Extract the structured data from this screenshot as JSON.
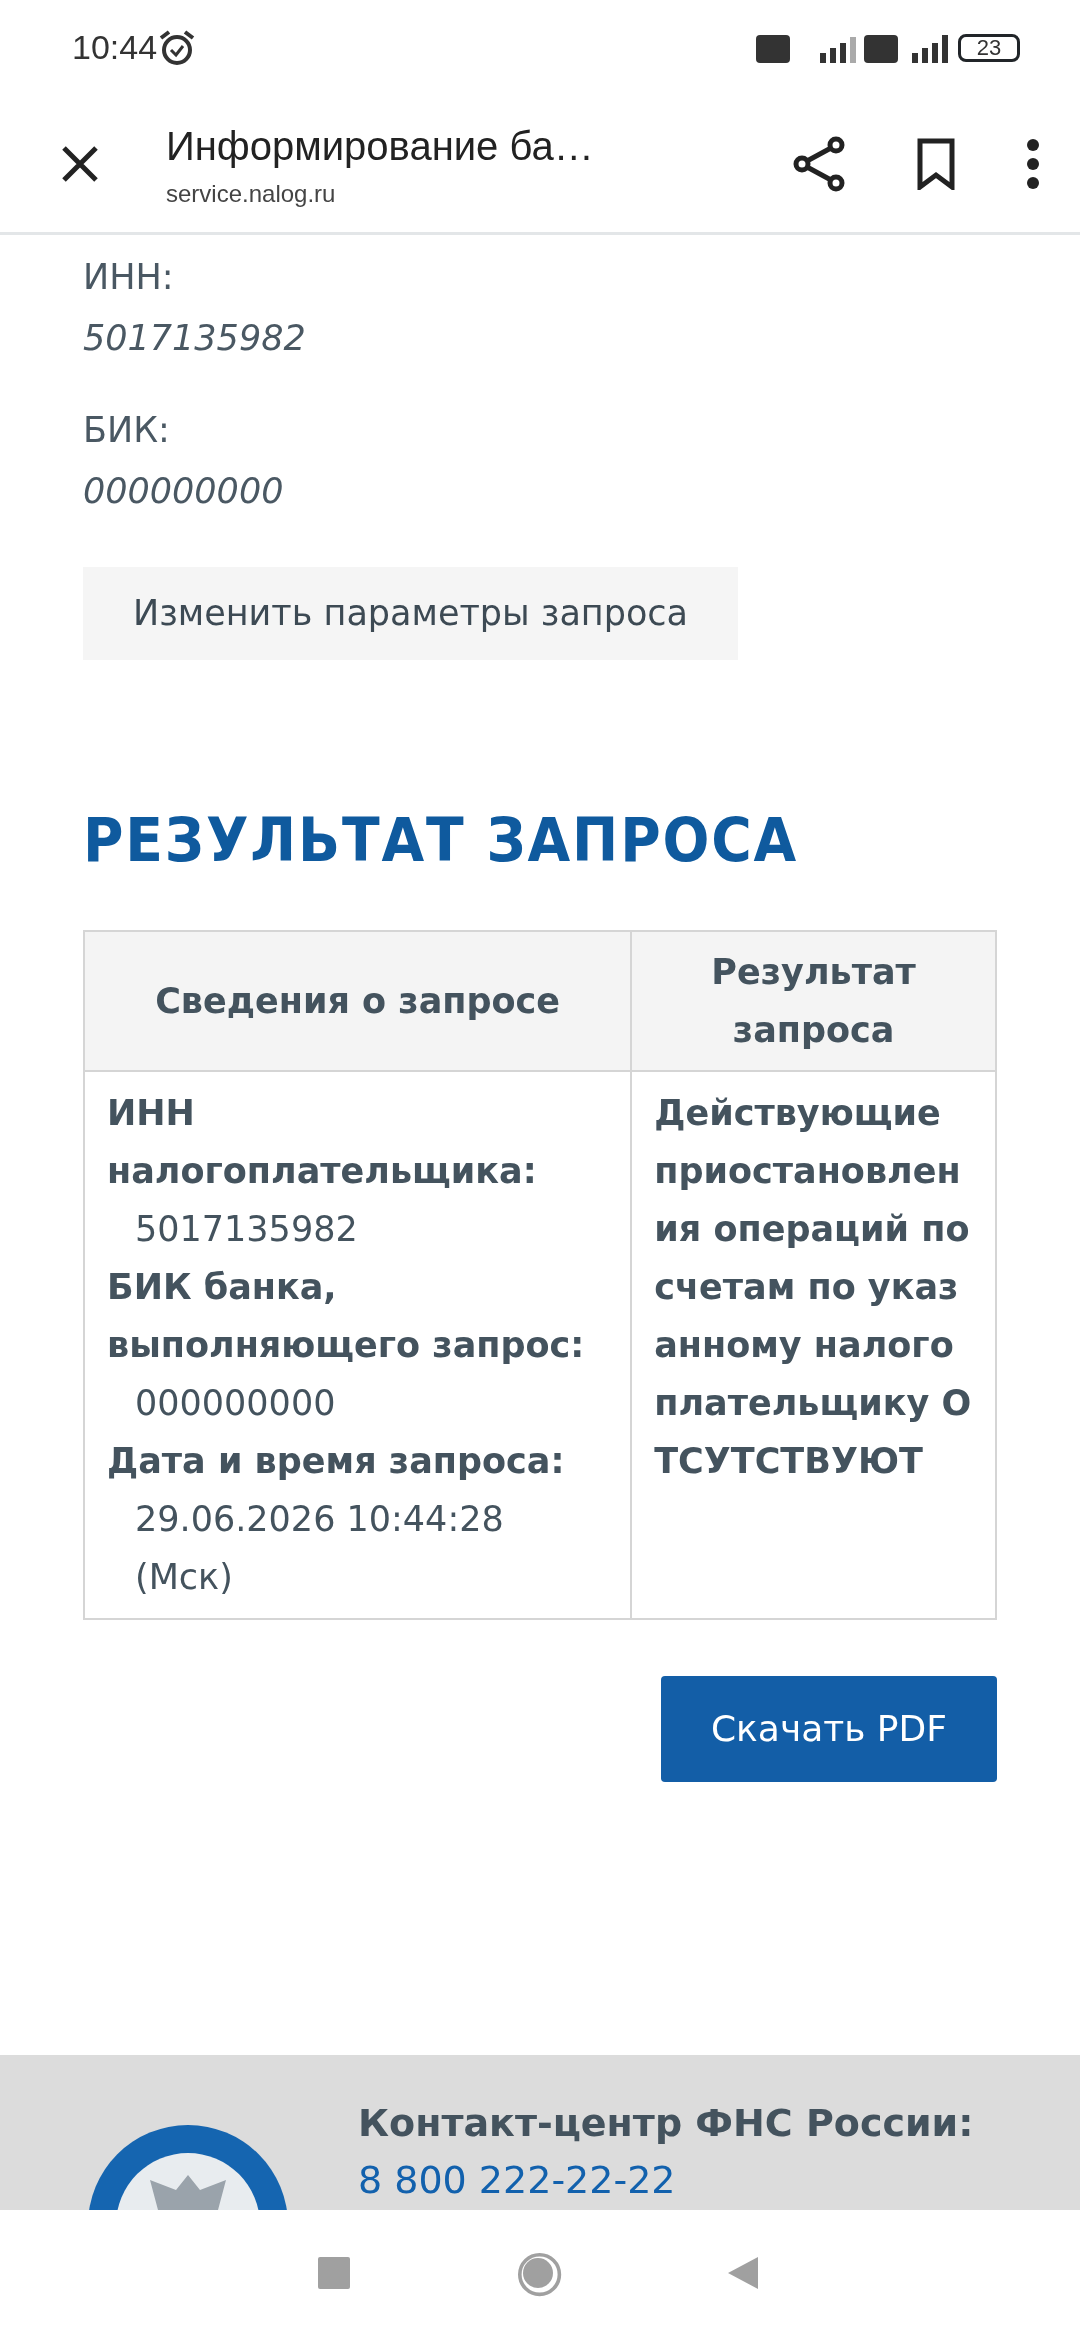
{
  "status_bar": {
    "time": "10:44",
    "battery": "23"
  },
  "browser_bar": {
    "title": "Информирование ба…",
    "url": "service.nalog.ru"
  },
  "fields": [
    {
      "label": "ИНН:",
      "value": "5017135982"
    },
    {
      "label": "БИК:",
      "value": "000000000"
    }
  ],
  "change_button": "Изменить параметры запроса",
  "heading": "РЕЗУЛЬТАТ ЗАПРОСА",
  "table": {
    "columns": [
      "Сведения о запросе",
      "Результат запроса"
    ],
    "details": [
      {
        "label": "ИНН налогоплательщика:",
        "value": "5017135982"
      },
      {
        "label": "БИК банка, выполняющего запрос:",
        "value": "000000000"
      },
      {
        "label": "Дата и время запроса:",
        "value": "29.06.2026 10:44:28 (Мск)"
      }
    ],
    "result": "Действующие приостановления операций по счетам по указанному налогоплательщику ОТСУТСТВУЮТ"
  },
  "download_button": "Скачать PDF",
  "footer": {
    "contact_title": "Контакт-центр ФНС России:",
    "phone": "8 800 222-22-22"
  }
}
